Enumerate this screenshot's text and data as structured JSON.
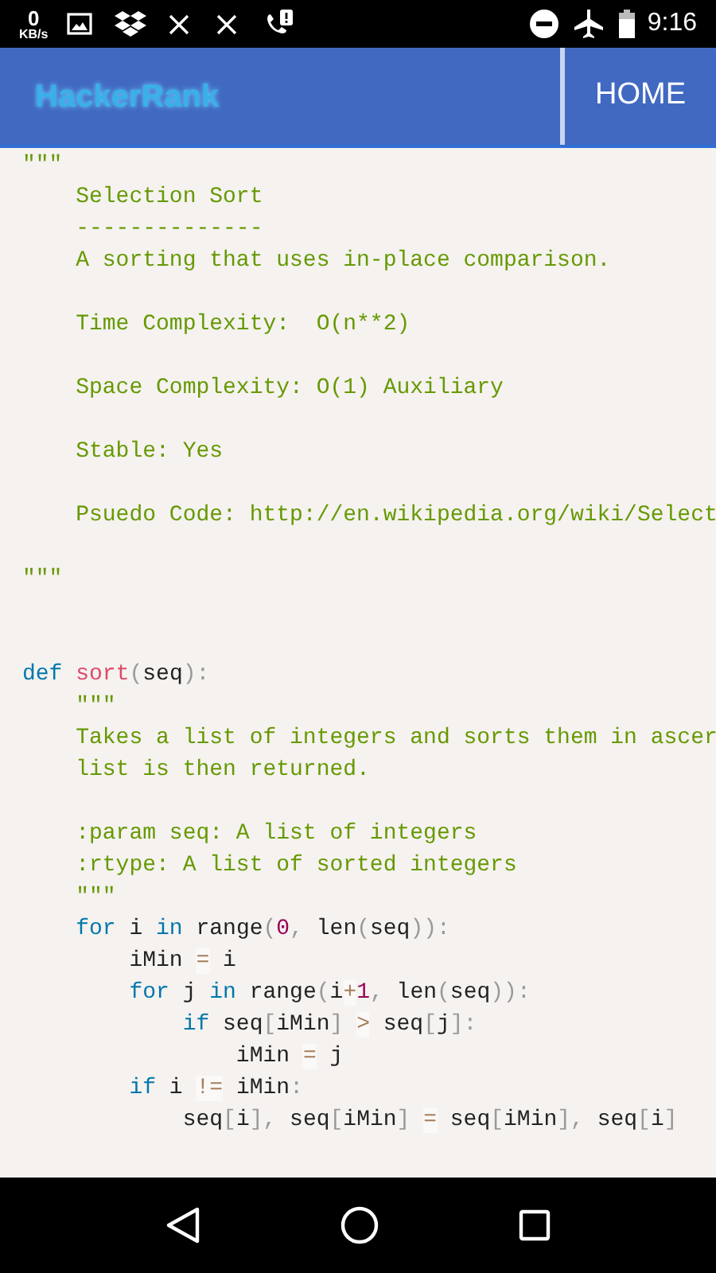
{
  "status_bar": {
    "speed_value": "0",
    "speed_unit": "KB/s",
    "time": "9:16"
  },
  "header": {
    "logo": "HackerRank",
    "nav": [
      {
        "label": "HOME"
      }
    ]
  },
  "code": {
    "lines": [
      {
        "kind": "code",
        "tokens": [
          {
            "kind": "string",
            "text": "\"\"\""
          }
        ]
      },
      {
        "kind": "code",
        "tokens": [
          {
            "kind": "string",
            "text": "    Selection Sort"
          }
        ]
      },
      {
        "kind": "code",
        "tokens": [
          {
            "kind": "string",
            "text": "    --------------"
          }
        ]
      },
      {
        "kind": "code",
        "tokens": [
          {
            "kind": "string",
            "text": "    A sorting that uses in-place comparison."
          }
        ]
      },
      {
        "kind": "blank"
      },
      {
        "kind": "code",
        "tokens": [
          {
            "kind": "string",
            "text": "    Time Complexity:  O(n**2)"
          }
        ]
      },
      {
        "kind": "blank"
      },
      {
        "kind": "code",
        "tokens": [
          {
            "kind": "string",
            "text": "    Space Complexity: O(1) Auxiliary"
          }
        ]
      },
      {
        "kind": "blank"
      },
      {
        "kind": "code",
        "tokens": [
          {
            "kind": "string",
            "text": "    Stable: Yes"
          }
        ]
      },
      {
        "kind": "blank"
      },
      {
        "kind": "code",
        "tokens": [
          {
            "kind": "string",
            "text": "    Psuedo Code: http://en.wikipedia.org/wiki/Select"
          }
        ]
      },
      {
        "kind": "blank"
      },
      {
        "kind": "code",
        "tokens": [
          {
            "kind": "string",
            "text": "\"\"\""
          }
        ]
      },
      {
        "kind": "blank"
      },
      {
        "kind": "blank"
      },
      {
        "kind": "code",
        "tokens": [
          {
            "kind": "keyword",
            "text": "def"
          },
          {
            "kind": "function",
            "text": " sort"
          },
          {
            "kind": "punctuation",
            "text": "("
          },
          {
            "kind": "plain",
            "text": "seq"
          },
          {
            "kind": "punctuation",
            "text": "):"
          }
        ]
      },
      {
        "kind": "code",
        "tokens": [
          {
            "kind": "string",
            "text": "    \"\"\""
          }
        ]
      },
      {
        "kind": "code",
        "tokens": [
          {
            "kind": "string",
            "text": "    Takes a list of integers and sorts them in ascer"
          }
        ]
      },
      {
        "kind": "code",
        "tokens": [
          {
            "kind": "string",
            "text": "    list is then returned."
          }
        ]
      },
      {
        "kind": "blank"
      },
      {
        "kind": "code",
        "tokens": [
          {
            "kind": "string",
            "text": "    :param seq: A list of integers"
          }
        ]
      },
      {
        "kind": "code",
        "tokens": [
          {
            "kind": "string",
            "text": "    :rtype: A list of sorted integers"
          }
        ]
      },
      {
        "kind": "code",
        "tokens": [
          {
            "kind": "string",
            "text": "    \"\"\""
          }
        ]
      },
      {
        "kind": "code",
        "tokens": [
          {
            "kind": "keyword",
            "text": "    for"
          },
          {
            "kind": "plain",
            "text": " i "
          },
          {
            "kind": "keyword",
            "text": "in"
          },
          {
            "kind": "plain",
            "text": " range"
          },
          {
            "kind": "punctuation",
            "text": "("
          },
          {
            "kind": "number",
            "text": "0"
          },
          {
            "kind": "punctuation",
            "text": ","
          },
          {
            "kind": "plain",
            "text": " len"
          },
          {
            "kind": "punctuation",
            "text": "("
          },
          {
            "kind": "plain",
            "text": "seq"
          },
          {
            "kind": "punctuation",
            "text": ")):"
          }
        ]
      },
      {
        "kind": "code",
        "tokens": [
          {
            "kind": "plain",
            "text": "        iMin "
          },
          {
            "kind": "operator",
            "text": "="
          },
          {
            "kind": "plain",
            "text": " i"
          }
        ]
      },
      {
        "kind": "code",
        "tokens": [
          {
            "kind": "keyword",
            "text": "        for"
          },
          {
            "kind": "plain",
            "text": " j "
          },
          {
            "kind": "keyword",
            "text": "in"
          },
          {
            "kind": "plain",
            "text": " range"
          },
          {
            "kind": "punctuation",
            "text": "("
          },
          {
            "kind": "plain",
            "text": "i"
          },
          {
            "kind": "operator",
            "text": "+"
          },
          {
            "kind": "number",
            "text": "1"
          },
          {
            "kind": "punctuation",
            "text": ","
          },
          {
            "kind": "plain",
            "text": " len"
          },
          {
            "kind": "punctuation",
            "text": "("
          },
          {
            "kind": "plain",
            "text": "seq"
          },
          {
            "kind": "punctuation",
            "text": ")):"
          }
        ]
      },
      {
        "kind": "code",
        "tokens": [
          {
            "kind": "keyword",
            "text": "            if"
          },
          {
            "kind": "plain",
            "text": " seq"
          },
          {
            "kind": "punctuation",
            "text": "["
          },
          {
            "kind": "plain",
            "text": "iMin"
          },
          {
            "kind": "punctuation",
            "text": "] "
          },
          {
            "kind": "operator",
            "text": ">"
          },
          {
            "kind": "plain",
            "text": " seq"
          },
          {
            "kind": "punctuation",
            "text": "["
          },
          {
            "kind": "plain",
            "text": "j"
          },
          {
            "kind": "punctuation",
            "text": "]:"
          }
        ]
      },
      {
        "kind": "code",
        "tokens": [
          {
            "kind": "plain",
            "text": "                iMin "
          },
          {
            "kind": "operator",
            "text": "="
          },
          {
            "kind": "plain",
            "text": " j"
          }
        ]
      },
      {
        "kind": "code",
        "tokens": [
          {
            "kind": "keyword",
            "text": "        if"
          },
          {
            "kind": "plain",
            "text": " i "
          },
          {
            "kind": "operator",
            "text": "!="
          },
          {
            "kind": "plain",
            "text": " iMin"
          },
          {
            "kind": "punctuation",
            "text": ":"
          }
        ]
      },
      {
        "kind": "code",
        "tokens": [
          {
            "kind": "plain",
            "text": "            seq"
          },
          {
            "kind": "punctuation",
            "text": "["
          },
          {
            "kind": "plain",
            "text": "i"
          },
          {
            "kind": "punctuation",
            "text": "],"
          },
          {
            "kind": "plain",
            "text": " seq"
          },
          {
            "kind": "punctuation",
            "text": "["
          },
          {
            "kind": "plain",
            "text": "iMin"
          },
          {
            "kind": "punctuation",
            "text": "] "
          },
          {
            "kind": "operator",
            "text": "="
          },
          {
            "kind": "plain",
            "text": " seq"
          },
          {
            "kind": "punctuation",
            "text": "["
          },
          {
            "kind": "plain",
            "text": "iMin"
          },
          {
            "kind": "punctuation",
            "text": "],"
          },
          {
            "kind": "plain",
            "text": " seq"
          },
          {
            "kind": "punctuation",
            "text": "["
          },
          {
            "kind": "plain",
            "text": "i"
          },
          {
            "kind": "punctuation",
            "text": "]"
          }
        ]
      },
      {
        "kind": "blank"
      }
    ]
  }
}
